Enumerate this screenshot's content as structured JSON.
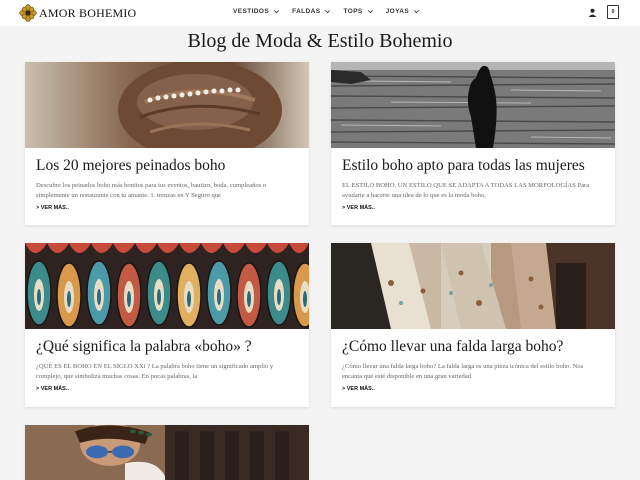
{
  "header": {
    "logo_text": "AMOR BOHEMIO",
    "nav": [
      {
        "label": "VESTIDOS"
      },
      {
        "label": "FALDAS"
      },
      {
        "label": "TOPS"
      },
      {
        "label": "JOYAS"
      }
    ],
    "cart_count": "0",
    "icons": [
      "flower-logo-icon",
      "chevron-down-icon",
      "user-icon",
      "cart-icon"
    ]
  },
  "page_title": "Blog de Moda & Estilo Bohemio",
  "posts": [
    {
      "title": "Los 20 mejores peinados boho",
      "excerpt": "Descubre los peinados boho más bonitos para tus eventos, bautizo, boda, cumpleaños o simplemente un restaurante con tu amante. 1. trenzas en Y Seguro que",
      "more": "> VER MÁS.."
    },
    {
      "title": "Estilo boho apto para todas las mujeres",
      "excerpt": "EL ESTILO BOHO, UN ESTILO QUE SE ADAPTA A  TODAS LAS MORFOLOGÍAS Para ayudarte a hacerte una idea de lo que es la moda boho,",
      "more": "> VER MÁS.."
    },
    {
      "title": "¿Qué significa la palabra «boho» ?",
      "excerpt": "¿QUÉ ES EL BOHO EN EL SIGLO XXi ? La palabra boho tiene un significado amplio y complejo, que simboliza muchas cosas. En pocas palabras, la",
      "more": "> VER MÁS.."
    },
    {
      "title": "¿Cómo llevar una falda larga boho?",
      "excerpt": "¿Cómo llevar una falda larga boho? La falda larga es una pieza icónica del estilo boho. Nos encanta que esté disponible en una gran variedad",
      "more": "> VER MÁS.."
    }
  ]
}
